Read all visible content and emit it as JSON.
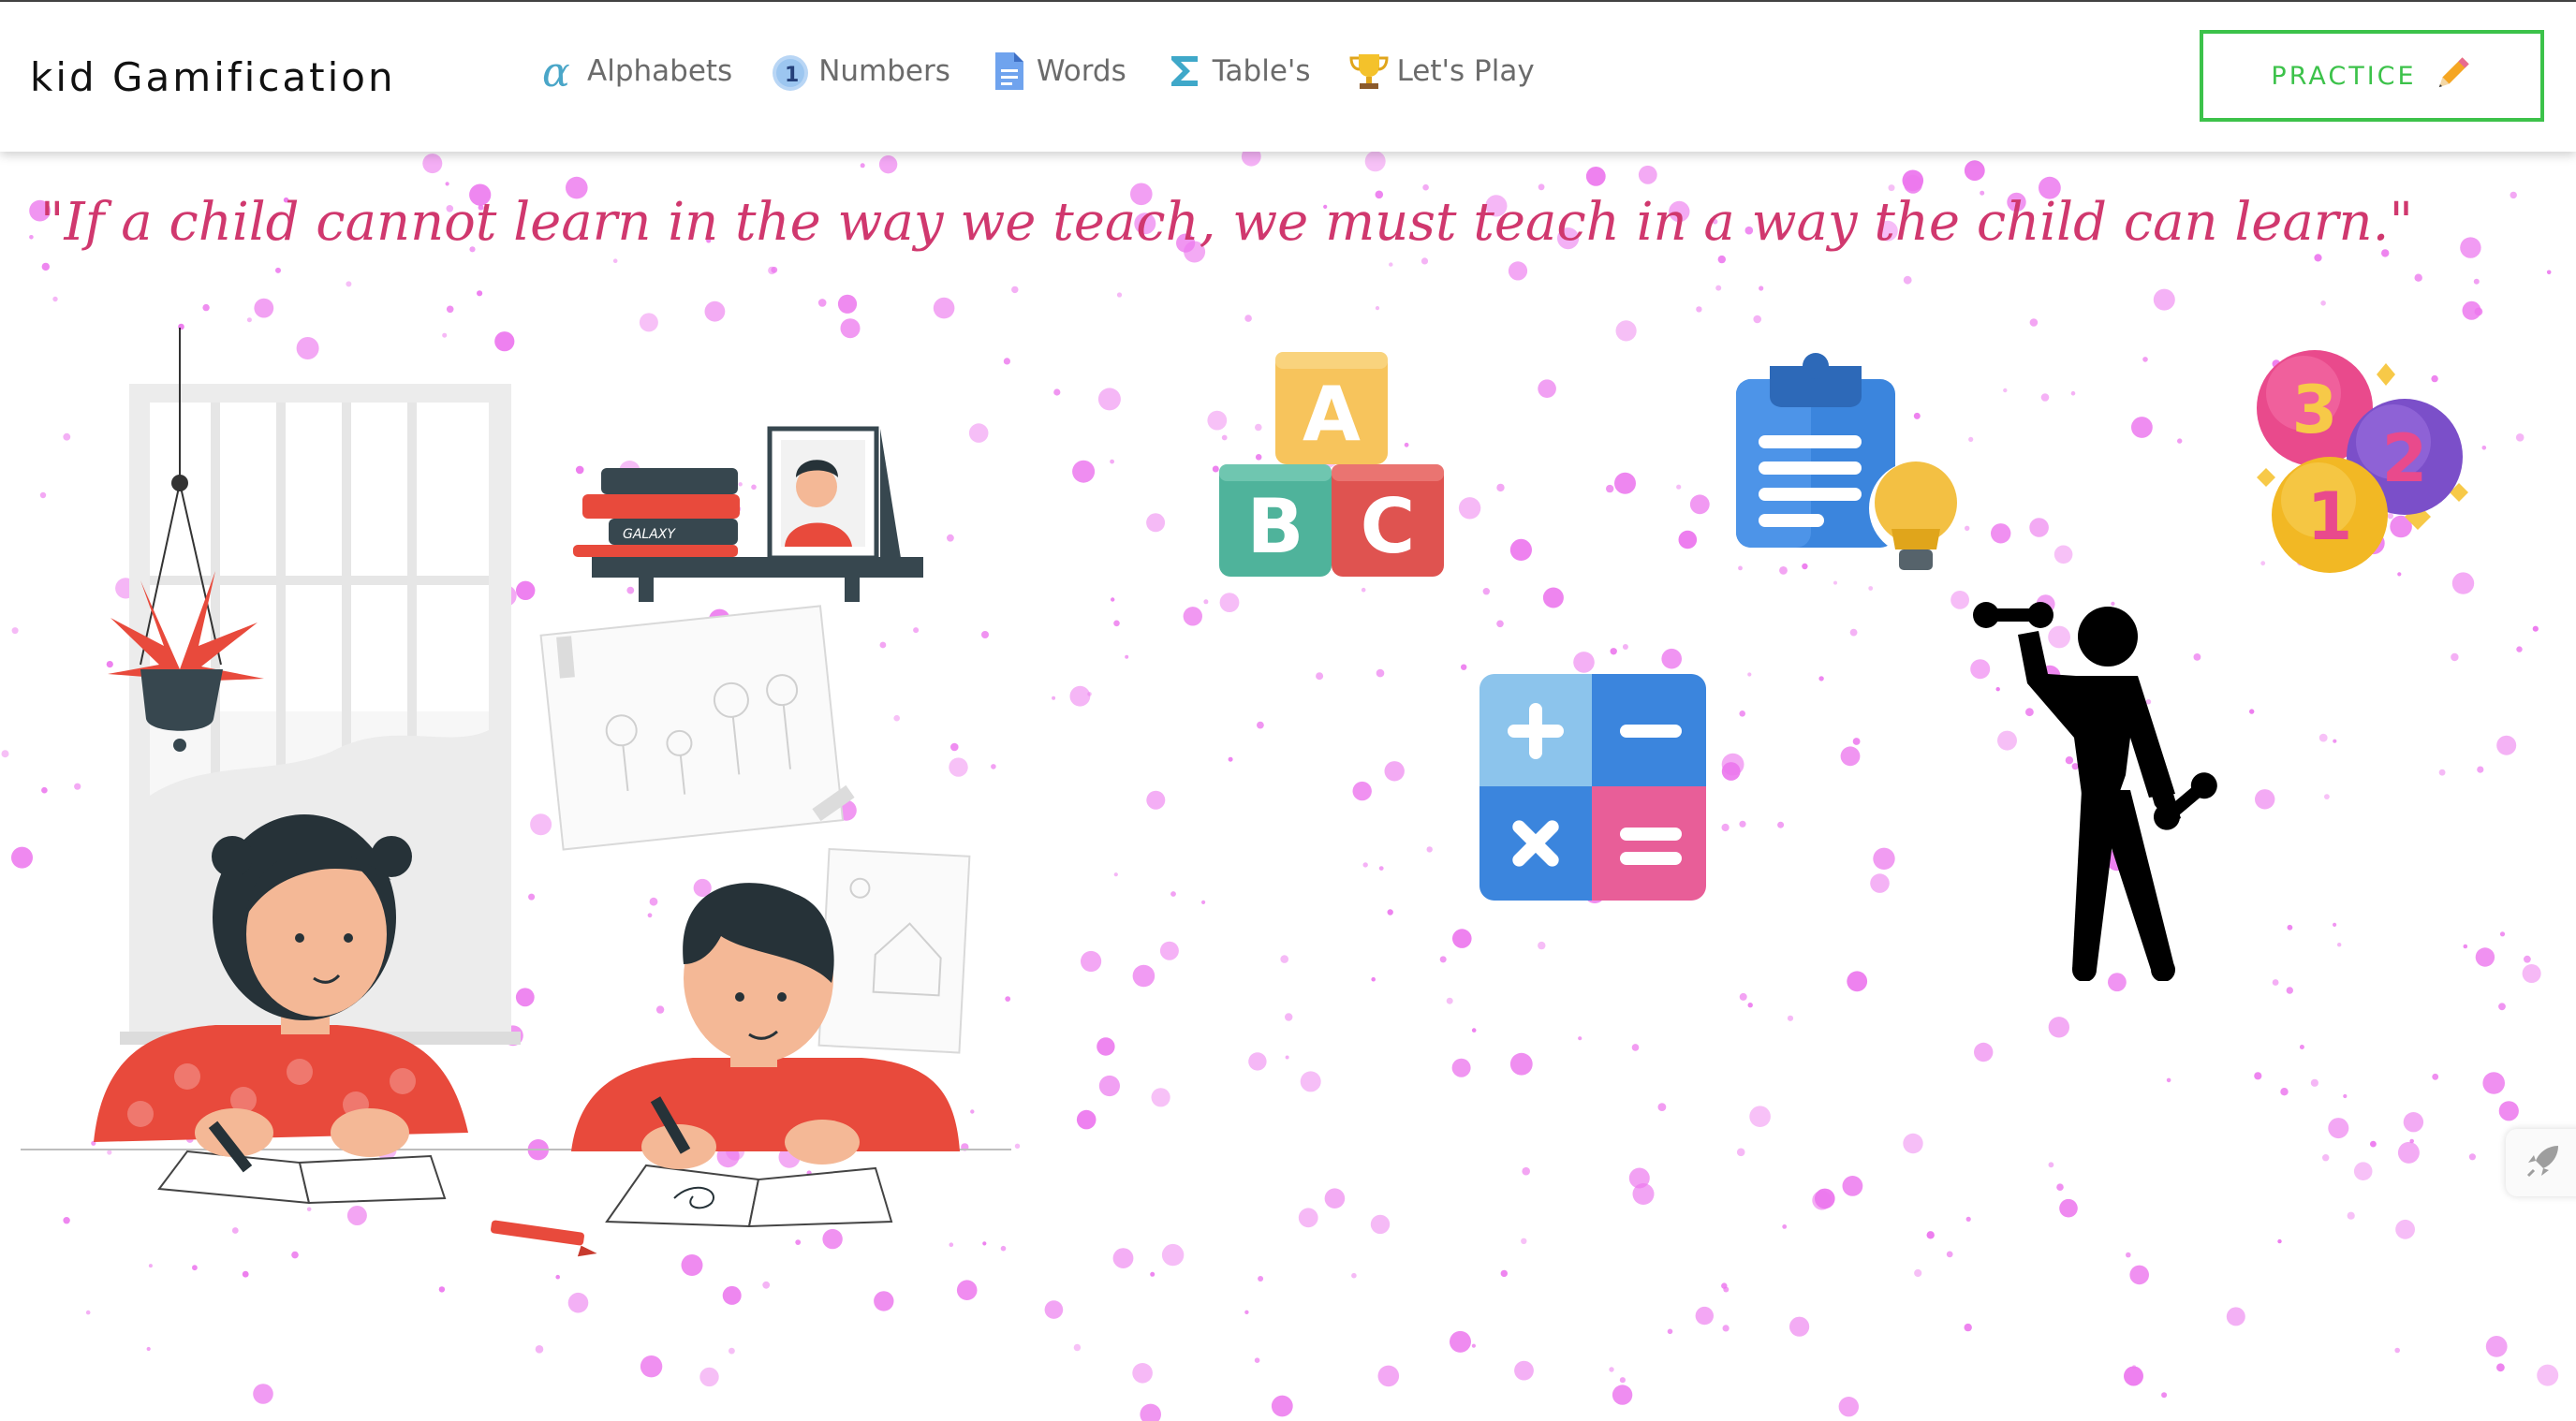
{
  "brand": {
    "title": "kid Gamification"
  },
  "nav": {
    "items": [
      {
        "label": "Alphabets",
        "icon": "alpha-icon"
      },
      {
        "label": "Numbers",
        "icon": "number-one-icon"
      },
      {
        "label": "Words",
        "icon": "document-icon"
      },
      {
        "label": "Table's",
        "icon": "sigma-icon"
      },
      {
        "label": "Let's Play",
        "icon": "trophy-icon"
      }
    ]
  },
  "practice": {
    "label": "PRACTICE",
    "icon": "pencil-icon"
  },
  "hero": {
    "quote": "\"If a child cannot learn in the way we teach, we must teach in a way the child can learn.\""
  },
  "illustrations": {
    "book_spine_text": "GALAXY",
    "abc_blocks": [
      "A",
      "B",
      "C"
    ],
    "number_balls": [
      "3",
      "2",
      "1"
    ]
  },
  "colors": {
    "accent_green": "#3cc24a",
    "quote_pink": "#d0386e",
    "dot_magenta": "#e040e8"
  }
}
